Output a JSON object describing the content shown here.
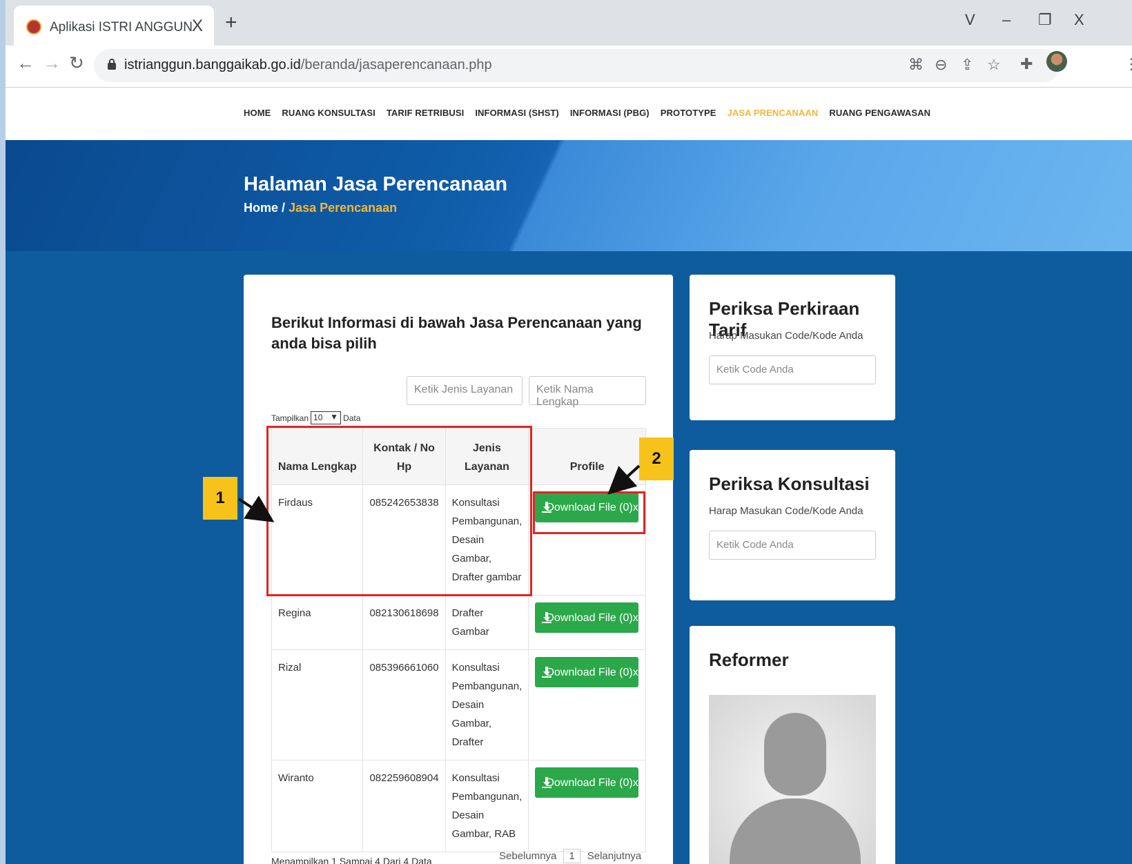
{
  "browser": {
    "tab_title": "Aplikasi ISTRI ANGGUN",
    "tab_close": "X",
    "new_tab": "+",
    "url_host": "istrianggun.banggaikab.go.id",
    "url_path": "/beranda/jasaperencanaan.php",
    "window_controls": {
      "dropdown": "V",
      "minimize": "–",
      "restore": "❐",
      "close": "X"
    }
  },
  "nav": {
    "items": [
      {
        "label": "HOME",
        "active": false
      },
      {
        "label": "RUANG KONSULTASI",
        "active": false
      },
      {
        "label": "TARIF RETRIBUSI",
        "active": false
      },
      {
        "label": "INFORMASI (SHST)",
        "active": false
      },
      {
        "label": "INFORMASI (PBG)",
        "active": false
      },
      {
        "label": "PROTOTYPE",
        "active": false
      },
      {
        "label": "JASA PRENCANAAN",
        "active": true
      },
      {
        "label": "RUANG PENGAWASAN",
        "active": false
      }
    ]
  },
  "hero": {
    "title": "Halaman Jasa Perencanaan",
    "crumb_home": "Home",
    "crumb_sep": "/",
    "crumb_current": "Jasa Perencanaan"
  },
  "main": {
    "title": "Berikut Informasi di bawah Jasa Perencanaan yang anda bisa pilih",
    "filter_service_placeholder": "Ketik Jenis Layanan",
    "filter_name_placeholder": "Ketik Nama Lengkap",
    "show_label": "Tampilkan",
    "show_value": "10",
    "show_suffix": "Data",
    "columns": [
      "Nama Lengkap",
      "Kontak / No Hp",
      "Jenis Layanan",
      "Profile"
    ],
    "rows": [
      {
        "name": "Firdaus",
        "phone": "085242653838",
        "service": "Konsultasi Pembangunan, Desain Gambar, Drafter gambar",
        "button": "Download File (0)x"
      },
      {
        "name": "Regina",
        "phone": "082130618698",
        "service": "Drafter Gambar",
        "button": "Download File (0)x"
      },
      {
        "name": "Rizal",
        "phone": "085396661060",
        "service": "Konsultasi Pembangunan, Desain Gambar, Drafter",
        "button": "Download File (0)x"
      },
      {
        "name": "Wiranto",
        "phone": "082259608904",
        "service": "Konsultasi Pembangunan, Desain Gambar, RAB",
        "button": "Download File (0)x"
      }
    ],
    "footer_info": "Menampilkan 1 Sampai 4 Dari 4 Data",
    "pager": {
      "prev": "Sebelumnya",
      "page": "1",
      "next": "Selanjutnya"
    }
  },
  "sidebar": {
    "tarif": {
      "title": "Periksa Perkiraan Tarif",
      "subtitle": "Harap Masukan Code/Kode Anda",
      "placeholder": "Ketik Code Anda"
    },
    "konsultasi": {
      "title": "Periksa Konsultasi",
      "subtitle": "Harap Masukan Code/Kode Anda",
      "placeholder": "Ketik Code Anda"
    },
    "reformer": {
      "title": "Reformer"
    }
  },
  "annotations": {
    "badge1": "1",
    "badge2": "2"
  },
  "colors": {
    "accent": "#f0b83a",
    "button_green": "#2ba84a",
    "page_blue": "#0e5c9e",
    "annotation_red": "#e32323",
    "badge_yellow": "#f7c31a"
  }
}
